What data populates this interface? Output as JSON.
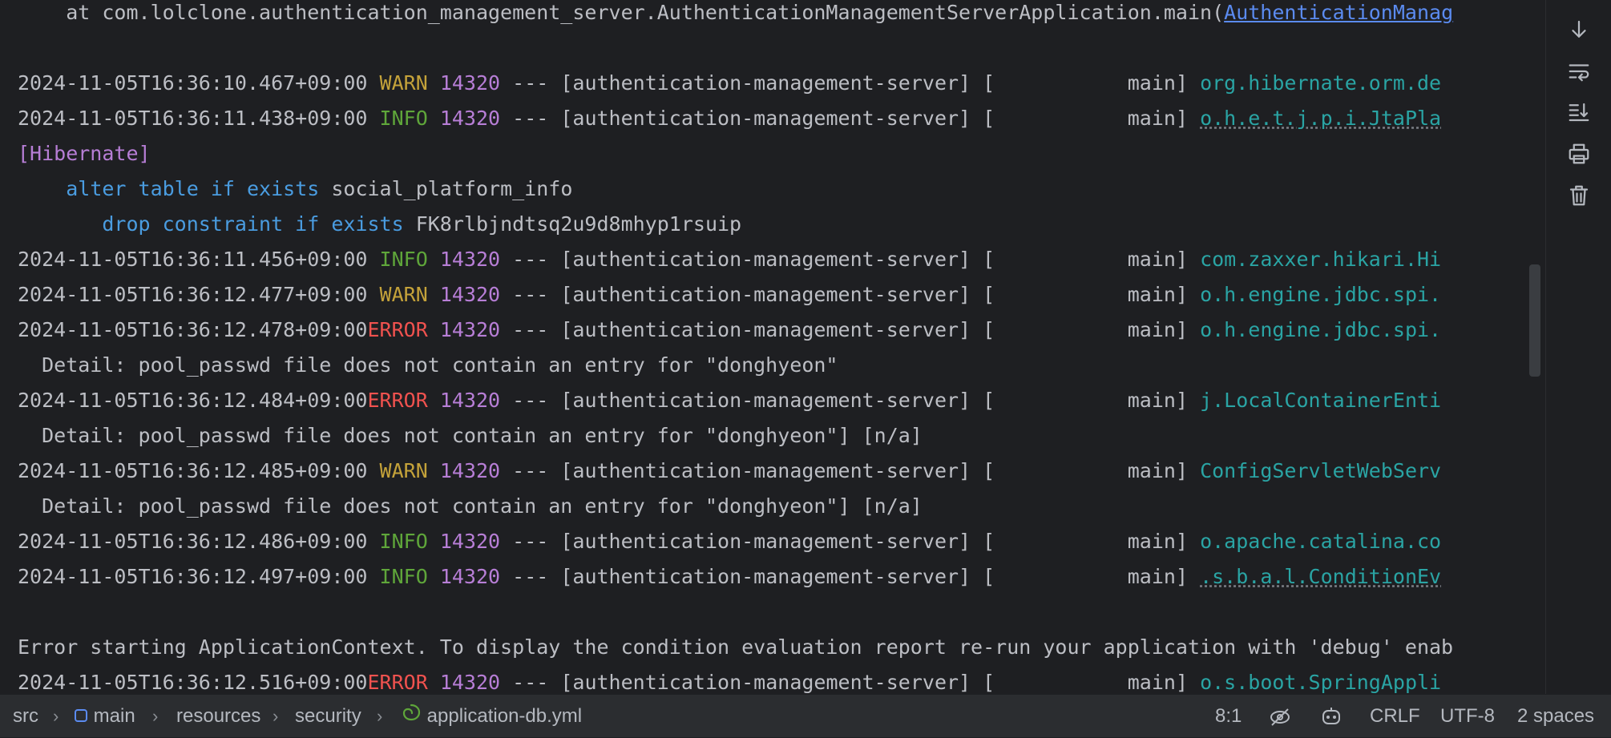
{
  "console": {
    "stack_line": {
      "prefix": "    at com.lolclone.authentication_management_server.AuthenticationManagementServerApplication.main(",
      "link": "AuthenticationManag"
    },
    "log_lines": [
      {
        "ts": "2024-11-05T16:36:10.467+09:00",
        "level": " WARN",
        "pid": "14320",
        "mid": " --- [authentication-management-server] [           main] ",
        "logger": "org.hibernate.orm.de"
      },
      {
        "ts": "2024-11-05T16:36:11.438+09:00",
        "level": " INFO",
        "pid": "14320",
        "mid": " --- [authentication-management-server] [           main] ",
        "logger": "o.h.e.t.j.p.i.JtaPla"
      },
      {
        "ts": "2024-11-05T16:36:11.456+09:00",
        "level": " INFO",
        "pid": "14320",
        "mid": " --- [authentication-management-server] [           main] ",
        "logger": "com.zaxxer.hikari.Hi"
      },
      {
        "ts": "2024-11-05T16:36:12.477+09:00",
        "level": " WARN",
        "pid": "14320",
        "mid": " --- [authentication-management-server] [           main] ",
        "logger": "o.h.engine.jdbc.spi."
      },
      {
        "ts": "2024-11-05T16:36:12.478+09:00",
        "level": "ERROR",
        "pid": "14320",
        "mid": " --- [authentication-management-server] [           main] ",
        "logger": "o.h.engine.jdbc.spi."
      },
      {
        "ts": "2024-11-05T16:36:12.484+09:00",
        "level": "ERROR",
        "pid": "14320",
        "mid": " --- [authentication-management-server] [           main] ",
        "logger": "j.LocalContainerEnti"
      },
      {
        "ts": "2024-11-05T16:36:12.485+09:00",
        "level": " WARN",
        "pid": "14320",
        "mid": " --- [authentication-management-server] [           main] ",
        "logger": "ConfigServletWebServ"
      },
      {
        "ts": "2024-11-05T16:36:12.486+09:00",
        "level": " INFO",
        "pid": "14320",
        "mid": " --- [authentication-management-server] [           main] ",
        "logger": "o.apache.catalina.co"
      },
      {
        "ts": "2024-11-05T16:36:12.497+09:00",
        "level": " INFO",
        "pid": "14320",
        "mid": " --- [authentication-management-server] [           main] ",
        "logger": ".s.b.a.l.ConditionEv"
      },
      {
        "ts": "2024-11-05T16:36:12.516+09:00",
        "level": "ERROR",
        "pid": "14320",
        "mid": " --- [authentication-management-server] [           main] ",
        "logger": "o.s.boot.SpringAppli"
      }
    ],
    "hibernate_tag": "[Hibernate]",
    "sql": {
      "alter_kw": "alter table if exists",
      "alter_rest": " social_platform_info",
      "drop_kw": "drop constraint if exists",
      "drop_rest": " FK8rlbjndtsq2u9d8mhyp1rsuip"
    },
    "details": [
      "  Detail: pool_passwd file does not contain an entry for \"donghyeon\"",
      "  Detail: pool_passwd file does not contain an entry for \"donghyeon\"] [n/a]",
      "  Detail: pool_passwd file does not contain an entry for \"donghyeon\"] [n/a]"
    ],
    "error_message": "Error starting ApplicationContext. To display the condition evaluation report re-run your application with 'debug' enab"
  },
  "sidebar": {
    "icons": [
      "scroll-to-end-icon",
      "soft-wrap-icon",
      "scroll-down-icon",
      "print-icon",
      "clear-all-icon"
    ]
  },
  "statusbar": {
    "breadcrumbs": [
      "src",
      "main",
      "resources",
      "security",
      "application-db.yml"
    ],
    "position": "8:1",
    "line_ending": "CRLF",
    "encoding": "UTF-8",
    "indent": "2 spaces"
  }
}
